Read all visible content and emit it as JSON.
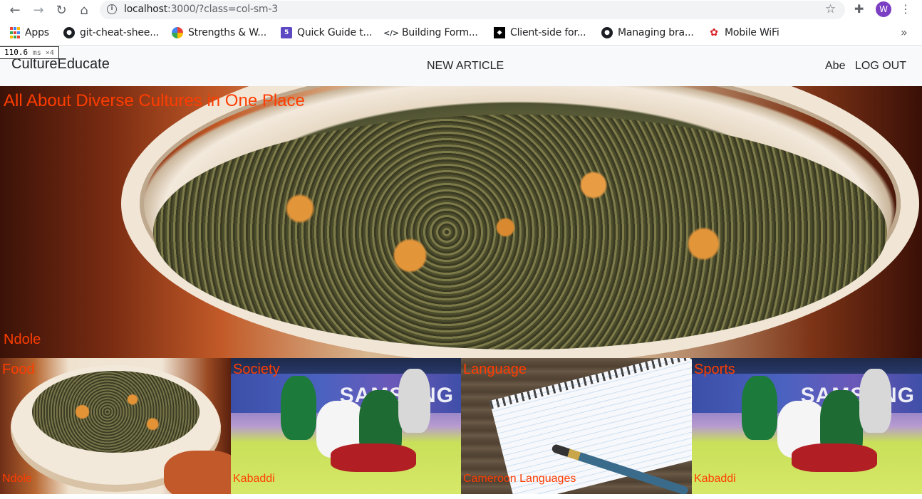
{
  "browser": {
    "url_host": "localhost",
    "url_rest": ":3000/?class=col-sm-3",
    "profile_initial": "W",
    "bookmarks": [
      {
        "label": "Apps",
        "icon": "apps-grid-icon"
      },
      {
        "label": "git-cheat-shee...",
        "icon": "github-icon"
      },
      {
        "label": "Strengths & W...",
        "icon": "strengths-icon"
      },
      {
        "label": "Quick Guide t...",
        "icon": "html5-icon"
      },
      {
        "label": "Building Form...",
        "icon": "code-icon"
      },
      {
        "label": "Client-side for...",
        "icon": "mdn-icon"
      },
      {
        "label": "Managing bra...",
        "icon": "github-icon"
      },
      {
        "label": "Mobile WiFi",
        "icon": "huawei-icon"
      }
    ]
  },
  "perf": {
    "value": "110.6",
    "unit": "ms ×4"
  },
  "nav": {
    "brand": "CultureEducate",
    "new_article": "NEW ARTICLE",
    "user": "Abe",
    "logout": "LOG OUT"
  },
  "hero": {
    "title": "All About Diverse Cultures in One Place",
    "caption": "Ndole"
  },
  "categories": [
    {
      "label": "Food",
      "caption": "Ndole"
    },
    {
      "label": "Society",
      "caption": "Kabaddi"
    },
    {
      "label": "Language",
      "caption": "Cameroon Languages"
    },
    {
      "label": "Sports",
      "caption": "Kabaddi"
    }
  ],
  "images": {
    "banner_text": "SAMSUNG"
  },
  "colors": {
    "accent": "#ff3d00",
    "navbar": "#f8f9fa"
  }
}
